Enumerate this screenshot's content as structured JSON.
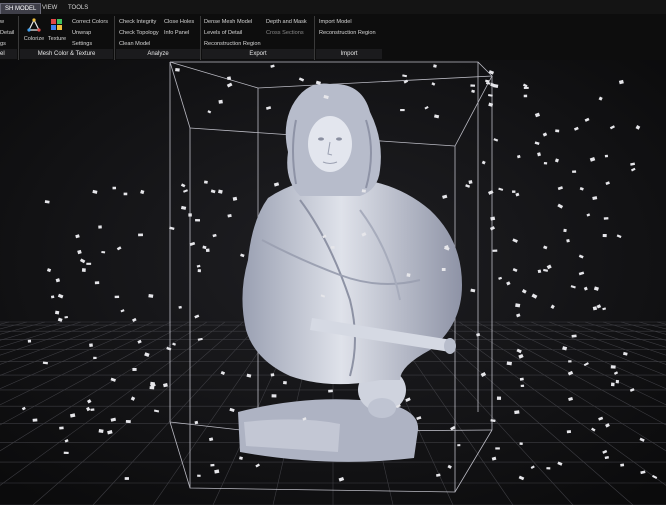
{
  "tabs": [
    {
      "label": "SH MODEL",
      "active": true
    },
    {
      "label": "VIEW",
      "active": false
    },
    {
      "label": "TOOLS",
      "active": false
    }
  ],
  "ribbon": {
    "partial_group": {
      "items": [
        "w",
        "Detail",
        "gs"
      ],
      "group_label": "el"
    },
    "mesh_color": {
      "colorize": "Colorize",
      "texture": "Texture",
      "items": [
        "Correct Colors",
        "Unwrap",
        "Settings"
      ],
      "group_label": "Mesh Color & Texture"
    },
    "analyze": {
      "col1": [
        "Check Integrity",
        "Check Topology",
        "Clean Model"
      ],
      "col2": [
        "Close Holes",
        "Info Panel"
      ],
      "group_label": "Analyze"
    },
    "export": {
      "col1": [
        "Dense Mesh Model",
        "Levels of Detail",
        "Reconstruction Region"
      ],
      "col2": [
        "Depth and Mask",
        "Cross Sections"
      ],
      "group_label": "Export"
    },
    "import": {
      "items": [
        "Import Model",
        "Reconstruction Region"
      ],
      "group_label": "Import"
    }
  },
  "colors": {
    "accent": "#2f6fb0",
    "ribbon_bg": "#0d0d0d",
    "viewport_bg": "#141416",
    "mesh": "#c9cdd8",
    "box": "#e0e0e8"
  },
  "icons": [
    "colorize-icon",
    "texture-icon",
    "camera-marker-icon"
  ]
}
